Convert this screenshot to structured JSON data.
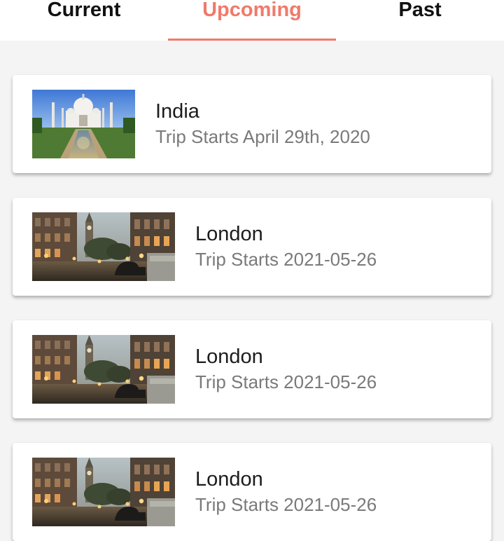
{
  "tabs": [
    {
      "label": "Current",
      "active": false
    },
    {
      "label": "Upcoming",
      "active": true
    },
    {
      "label": "Past",
      "active": false
    }
  ],
  "colors": {
    "accent": "#f07a6a",
    "tab_text": "#111111",
    "title_text": "#1c1c1c",
    "subtitle_text": "#7a7a7a",
    "background": "#f4f4f4",
    "card": "#ffffff"
  },
  "trips": [
    {
      "destination": "India",
      "start": "Trip Starts April 29th, 2020",
      "image": "taj-mahal-photo"
    },
    {
      "destination": "London",
      "start": "Trip Starts 2021-05-26",
      "image": "london-street-photo"
    },
    {
      "destination": "London",
      "start": "Trip Starts 2021-05-26",
      "image": "london-street-photo"
    },
    {
      "destination": "London",
      "start": "Trip Starts 2021-05-26",
      "image": "london-street-photo"
    }
  ]
}
